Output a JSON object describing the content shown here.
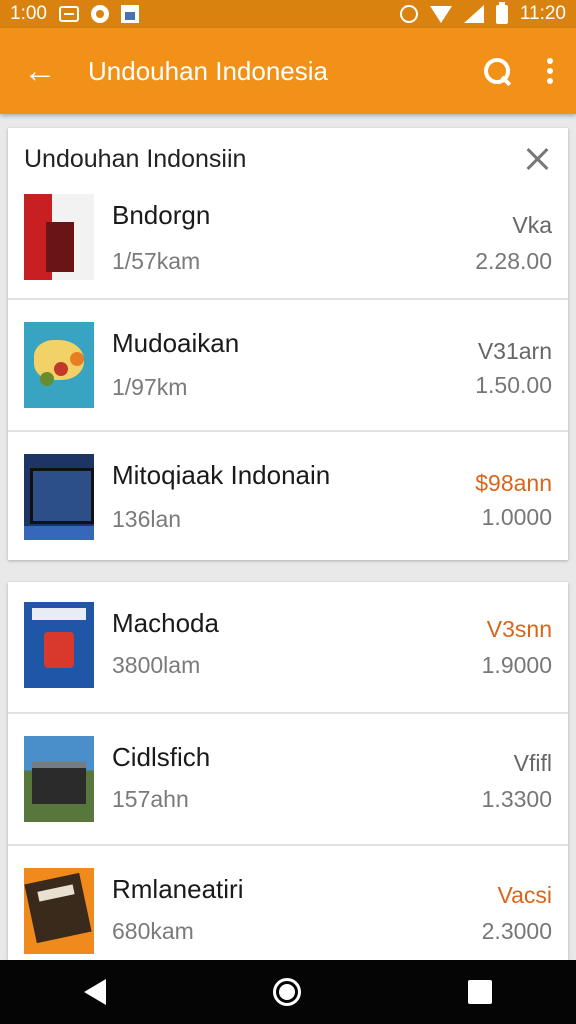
{
  "status_bar": {
    "time_left": "1:00",
    "time_right": "11:20",
    "left_icons": [
      "message-icon",
      "record-icon",
      "image-icon"
    ],
    "right_icons": [
      "alarm-icon",
      "wifi-icon",
      "signal-icon",
      "battery-icon"
    ]
  },
  "app_bar": {
    "title": "Undouhan Indonesia",
    "back_icon": "arrow-back-icon",
    "actions": [
      "search-icon",
      "more-vert-icon"
    ]
  },
  "card1": {
    "title": "Undouhan Indonsiin",
    "items": [
      {
        "name": "Bndorgn",
        "meta": "1/57kam",
        "tag": "Vka",
        "price": "2.28.00",
        "accent": false
      },
      {
        "name": "Mudoaikan",
        "meta": "1/97km",
        "tag": "V31arn",
        "price": "1.50.00",
        "accent": false
      },
      {
        "name": "Mitoqiaak Indonain",
        "meta": "136lan",
        "tag": "$98ann",
        "price": "1.0000",
        "accent": true
      }
    ]
  },
  "card2": {
    "items": [
      {
        "name": "Machoda",
        "meta": "3800lam",
        "tag": "V3snn",
        "price": "1.9000",
        "accent": true
      },
      {
        "name": "Cidlsfich",
        "meta": "157ahn",
        "tag": "Vfifl",
        "price": "1.3300",
        "accent": false
      },
      {
        "name": "Rmlaneatiri",
        "meta": "680kam",
        "tag": "Vacsi",
        "price": "2.3000",
        "accent": true
      }
    ]
  },
  "nav_bar": {
    "buttons": [
      "back-triangle-icon",
      "home-circle-icon",
      "recents-square-icon"
    ]
  },
  "colors": {
    "app_bar": "#f29117",
    "status_bar": "#d9820f",
    "accent_text": "#d9651b"
  }
}
